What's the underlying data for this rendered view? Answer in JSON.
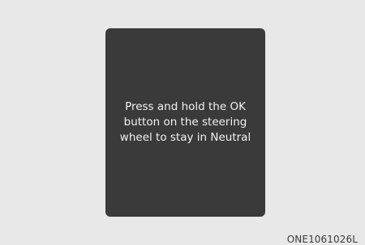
{
  "display": {
    "message": "Press and hold the OK\nbutton on the steering\nwheel to stay in Neutral"
  },
  "figure_code": "ONE1061026L"
}
